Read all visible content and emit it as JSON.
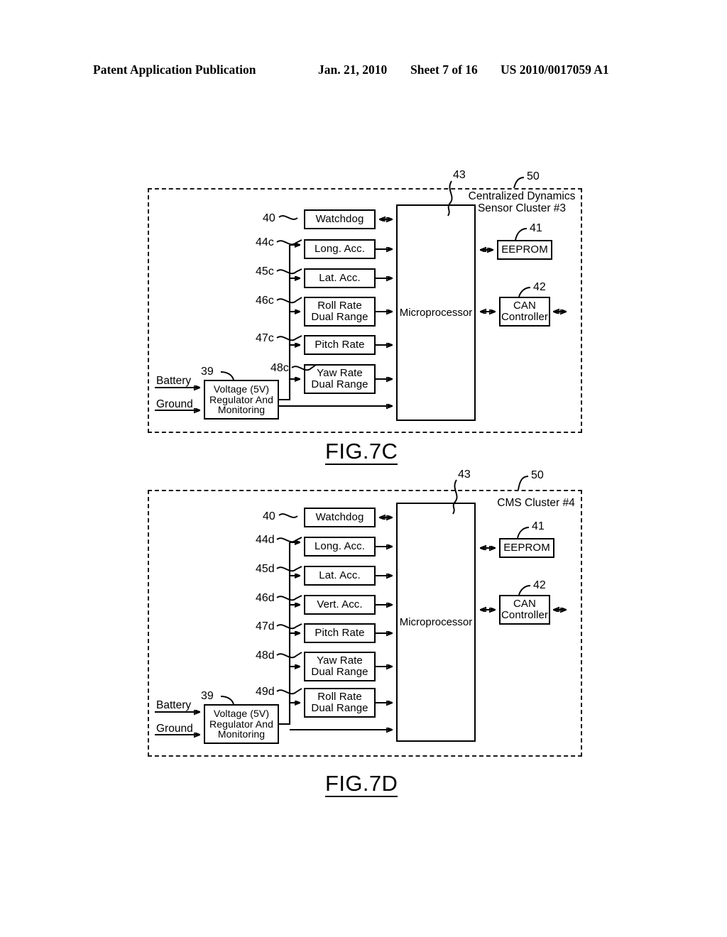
{
  "header": {
    "publication": "Patent Application Publication",
    "date": "Jan. 21, 2010",
    "sheet": "Sheet 7 of 16",
    "patent_number": "US 2010/0017059 A1"
  },
  "figures": [
    {
      "caption": "FIG.7C",
      "cluster_title": "Centralized Dynamics\nSensor Cluster #3",
      "cluster_ref": "50",
      "mcu_label": "Microprocessor",
      "mcu_ref": "43",
      "power": {
        "battery_label": "Battery",
        "ground_label": "Ground",
        "regulator_label": "Voltage (5V)\nRegulator And\nMonitoring",
        "regulator_ref": "39"
      },
      "blocks": [
        {
          "label": "Watchdog",
          "ref": "40",
          "lines": 1,
          "arrow": "bidirectional"
        },
        {
          "label": "Long. Acc.",
          "ref": "44c",
          "lines": 1,
          "arrow": "out"
        },
        {
          "label": "Lat. Acc.",
          "ref": "45c",
          "lines": 1,
          "arrow": "out"
        },
        {
          "label": "Roll Rate\nDual Range",
          "ref": "46c",
          "lines": 2,
          "arrow": "out"
        },
        {
          "label": "Pitch Rate",
          "ref": "47c",
          "lines": 1,
          "arrow": "out"
        },
        {
          "label": "Yaw Rate\nDual Range",
          "ref": "48c",
          "lines": 2,
          "arrow": "out"
        }
      ],
      "peripherals": [
        {
          "label": "EEPROM",
          "ref": "41",
          "lines": 1,
          "external_out": false
        },
        {
          "label": "CAN\nController",
          "ref": "42",
          "lines": 2,
          "external_out": true
        }
      ]
    },
    {
      "caption": "FIG.7D",
      "cluster_title": "CMS Cluster #4",
      "cluster_ref": "50",
      "mcu_label": "Microprocessor",
      "mcu_ref": "43",
      "power": {
        "battery_label": "Battery",
        "ground_label": "Ground",
        "regulator_label": "Voltage (5V)\nRegulator And\nMonitoring",
        "regulator_ref": "39"
      },
      "blocks": [
        {
          "label": "Watchdog",
          "ref": "40",
          "lines": 1,
          "arrow": "bidirectional"
        },
        {
          "label": "Long. Acc.",
          "ref": "44d",
          "lines": 1,
          "arrow": "out"
        },
        {
          "label": "Lat. Acc.",
          "ref": "45d",
          "lines": 1,
          "arrow": "out"
        },
        {
          "label": "Vert. Acc.",
          "ref": "46d",
          "lines": 1,
          "arrow": "out"
        },
        {
          "label": "Pitch Rate",
          "ref": "47d",
          "lines": 1,
          "arrow": "out"
        },
        {
          "label": "Yaw Rate\nDual Range",
          "ref": "48d",
          "lines": 2,
          "arrow": "out"
        },
        {
          "label": "Roll Rate\nDual Range",
          "ref": "49d",
          "lines": 2,
          "arrow": "out"
        }
      ],
      "peripherals": [
        {
          "label": "EEPROM",
          "ref": "41",
          "lines": 1,
          "external_out": false
        },
        {
          "label": "CAN\nController",
          "ref": "42",
          "lines": 2,
          "external_out": true
        }
      ]
    }
  ]
}
